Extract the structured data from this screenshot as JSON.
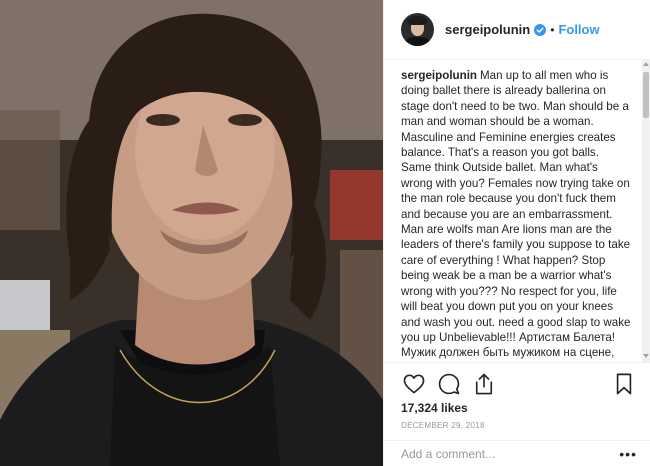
{
  "post": {
    "username": "sergeipolunin",
    "separator": "•",
    "follow_label": "Follow",
    "caption_username": "sergeipolunin",
    "caption_text": "Man up to all men who is doing ballet there is already ballerina on stage don't need to be two. Man should be a man and woman should be a woman. Masculine and Feminine energies creates balance. That's a reason you got balls. Same think Outside ballet. Man what's wrong with you? Females now trying take on the man role because you don't fuck them and because you are an embarrassment. Man are wolfs man Are lions man are the leaders of there's family you suppose to take care of everything ! What happen? Stop being weak be a man be a warrior what's wrong with you??? No respect for you, life will beat you down put you on your knees and wash you out. need a good slap to wake you up Unbelievable!!! Артистам Балета! Мужик должен быть мужиком на сцене, уже есть балерина, ...",
    "likes": "17,324 likes",
    "date": "December 29, 2018",
    "comment_placeholder": "Add a comment...",
    "more_label": "•••"
  },
  "icons": {
    "verified": "verified-badge-icon",
    "like": "heart-icon",
    "comment": "comment-icon",
    "share": "share-icon",
    "save": "bookmark-icon"
  },
  "colors": {
    "link": "#3897f0",
    "text": "#262626",
    "muted": "#999999",
    "border": "#efefef"
  }
}
